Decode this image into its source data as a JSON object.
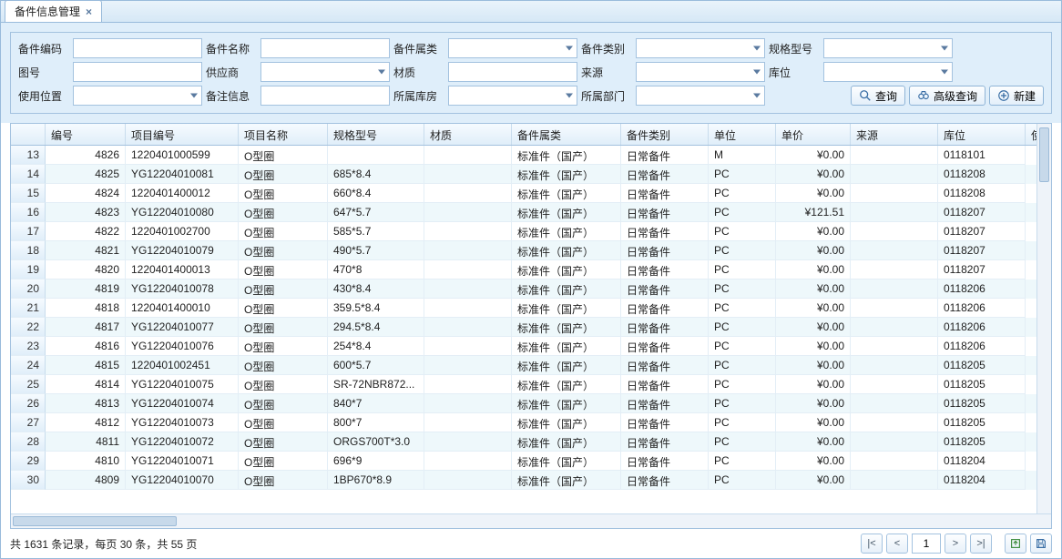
{
  "tab": {
    "title": "备件信息管理"
  },
  "filters": {
    "labels": {
      "code": "备件编码",
      "name": "备件名称",
      "attr": "备件属类",
      "cat": "备件类别",
      "spec": "规格型号",
      "drawing": "图号",
      "supplier": "供应商",
      "material": "材质",
      "source": "来源",
      "loc": "库位",
      "usepos": "使用位置",
      "remark": "备注信息",
      "warehouse": "所属库房",
      "dept": "所属部门"
    },
    "buttons": {
      "search": "查询",
      "adv": "高级查询",
      "new": "新建"
    }
  },
  "grid": {
    "headers": {
      "rownum": "",
      "id": "编号",
      "proj": "项目编号",
      "name": "项目名称",
      "spec": "规格型号",
      "material": "材质",
      "attr": "备件属类",
      "cat": "备件类别",
      "unit": "单位",
      "price": "单价",
      "source": "来源",
      "loc": "库位",
      "extra": "使"
    },
    "rows": [
      {
        "n": 13,
        "id": "4826",
        "proj": "1220401000599",
        "name": "O型圈",
        "spec": "",
        "mat": "",
        "attr": "标准件（国产）",
        "cat": "日常备件",
        "unit": "M",
        "price": "¥0.00",
        "src": "",
        "loc": "0118101"
      },
      {
        "n": 14,
        "id": "4825",
        "proj": "YG12204010081",
        "name": "O型圈",
        "spec": "685*8.4",
        "mat": "",
        "attr": "标准件（国产）",
        "cat": "日常备件",
        "unit": "PC",
        "price": "¥0.00",
        "src": "",
        "loc": "0118208"
      },
      {
        "n": 15,
        "id": "4824",
        "proj": "1220401400012",
        "name": "O型圈",
        "spec": "660*8.4",
        "mat": "",
        "attr": "标准件（国产）",
        "cat": "日常备件",
        "unit": "PC",
        "price": "¥0.00",
        "src": "",
        "loc": "0118208"
      },
      {
        "n": 16,
        "id": "4823",
        "proj": "YG12204010080",
        "name": "O型圈",
        "spec": "647*5.7",
        "mat": "",
        "attr": "标准件（国产）",
        "cat": "日常备件",
        "unit": "PC",
        "price": "¥121.51",
        "src": "",
        "loc": "0118207"
      },
      {
        "n": 17,
        "id": "4822",
        "proj": "1220401002700",
        "name": "O型圈",
        "spec": "585*5.7",
        "mat": "",
        "attr": "标准件（国产）",
        "cat": "日常备件",
        "unit": "PC",
        "price": "¥0.00",
        "src": "",
        "loc": "0118207"
      },
      {
        "n": 18,
        "id": "4821",
        "proj": "YG12204010079",
        "name": "O型圈",
        "spec": "490*5.7",
        "mat": "",
        "attr": "标准件（国产）",
        "cat": "日常备件",
        "unit": "PC",
        "price": "¥0.00",
        "src": "",
        "loc": "0118207"
      },
      {
        "n": 19,
        "id": "4820",
        "proj": "1220401400013",
        "name": "O型圈",
        "spec": "470*8",
        "mat": "",
        "attr": "标准件（国产）",
        "cat": "日常备件",
        "unit": "PC",
        "price": "¥0.00",
        "src": "",
        "loc": "0118207"
      },
      {
        "n": 20,
        "id": "4819",
        "proj": "YG12204010078",
        "name": "O型圈",
        "spec": "430*8.4",
        "mat": "",
        "attr": "标准件（国产）",
        "cat": "日常备件",
        "unit": "PC",
        "price": "¥0.00",
        "src": "",
        "loc": "0118206"
      },
      {
        "n": 21,
        "id": "4818",
        "proj": "1220401400010",
        "name": "O型圈",
        "spec": "359.5*8.4",
        "mat": "",
        "attr": "标准件（国产）",
        "cat": "日常备件",
        "unit": "PC",
        "price": "¥0.00",
        "src": "",
        "loc": "0118206"
      },
      {
        "n": 22,
        "id": "4817",
        "proj": "YG12204010077",
        "name": "O型圈",
        "spec": "294.5*8.4",
        "mat": "",
        "attr": "标准件（国产）",
        "cat": "日常备件",
        "unit": "PC",
        "price": "¥0.00",
        "src": "",
        "loc": "0118206"
      },
      {
        "n": 23,
        "id": "4816",
        "proj": "YG12204010076",
        "name": "O型圈",
        "spec": "254*8.4",
        "mat": "",
        "attr": "标准件（国产）",
        "cat": "日常备件",
        "unit": "PC",
        "price": "¥0.00",
        "src": "",
        "loc": "0118206"
      },
      {
        "n": 24,
        "id": "4815",
        "proj": "1220401002451",
        "name": "O型圈",
        "spec": "600*5.7",
        "mat": "",
        "attr": "标准件（国产）",
        "cat": "日常备件",
        "unit": "PC",
        "price": "¥0.00",
        "src": "",
        "loc": "0118205"
      },
      {
        "n": 25,
        "id": "4814",
        "proj": "YG12204010075",
        "name": "O型圈",
        "spec": "SR-72NBR872...",
        "mat": "",
        "attr": "标准件（国产）",
        "cat": "日常备件",
        "unit": "PC",
        "price": "¥0.00",
        "src": "",
        "loc": "0118205"
      },
      {
        "n": 26,
        "id": "4813",
        "proj": "YG12204010074",
        "name": "O型圈",
        "spec": "840*7",
        "mat": "",
        "attr": "标准件（国产）",
        "cat": "日常备件",
        "unit": "PC",
        "price": "¥0.00",
        "src": "",
        "loc": "0118205"
      },
      {
        "n": 27,
        "id": "4812",
        "proj": "YG12204010073",
        "name": "O型圈",
        "spec": "800*7",
        "mat": "",
        "attr": "标准件（国产）",
        "cat": "日常备件",
        "unit": "PC",
        "price": "¥0.00",
        "src": "",
        "loc": "0118205"
      },
      {
        "n": 28,
        "id": "4811",
        "proj": "YG12204010072",
        "name": "O型圈",
        "spec": "ORGS700T*3.0",
        "mat": "",
        "attr": "标准件（国产）",
        "cat": "日常备件",
        "unit": "PC",
        "price": "¥0.00",
        "src": "",
        "loc": "0118205"
      },
      {
        "n": 29,
        "id": "4810",
        "proj": "YG12204010071",
        "name": "O型圈",
        "spec": "696*9",
        "mat": "",
        "attr": "标准件（国产）",
        "cat": "日常备件",
        "unit": "PC",
        "price": "¥0.00",
        "src": "",
        "loc": "0118204"
      },
      {
        "n": 30,
        "id": "4809",
        "proj": "YG12204010070",
        "name": "O型圈",
        "spec": "1BP670*8.9",
        "mat": "",
        "attr": "标准件（国产）",
        "cat": "日常备件",
        "unit": "PC",
        "price": "¥0.00",
        "src": "",
        "loc": "0118204"
      }
    ]
  },
  "footer": {
    "summary": "共 1631 条记录，每页 30 条，共 55 页",
    "page": "1",
    "first": "|<",
    "prev": "<",
    "next": ">",
    "last": ">|"
  }
}
